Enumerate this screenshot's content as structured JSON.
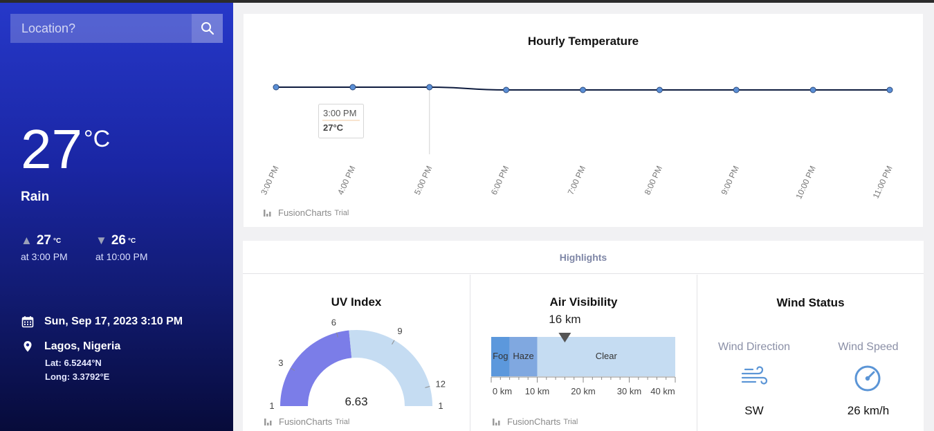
{
  "search": {
    "placeholder": "Location?"
  },
  "current": {
    "temperature": "27",
    "unit": "°C",
    "condition": "Rain",
    "high": {
      "value": "27",
      "unit": "°C",
      "at": "at 3:00 PM"
    },
    "low": {
      "value": "26",
      "unit": "°C",
      "at": "at 10:00 PM"
    },
    "datetime": "Sun, Sep 17, 2023 3:10 PM",
    "location": "Lagos, Nigeria",
    "lat": "Lat: 6.5244°N",
    "long": "Long: 3.3792°E"
  },
  "icons": {
    "search": "search-icon",
    "calendar": "calendar-icon",
    "location": "map-pin-icon",
    "wind": "wind-icon",
    "speed": "speedometer-icon"
  },
  "chart_data": [
    {
      "type": "line",
      "title": "Hourly Temperature",
      "x": [
        "3:00 PM",
        "4:00 PM",
        "5:00 PM",
        "6:00 PM",
        "7:00 PM",
        "8:00 PM",
        "9:00 PM",
        "10:00 PM",
        "11:00 PM"
      ],
      "values": [
        27,
        27,
        27,
        26,
        26,
        26,
        26,
        26,
        26
      ],
      "unit": "°C",
      "tooltip": {
        "label": "3:00 PM",
        "value": "27°C"
      },
      "color": "#0d1b3e",
      "marker_color": "#5b8fd6"
    }
  ],
  "trial_watermark": {
    "brand": "FusionCharts",
    "suffix": "Trial"
  },
  "highlights": {
    "title": "Highlights",
    "uv": {
      "title": "UV Index",
      "value": 6.63,
      "value_text": "6.63",
      "min_label": "1",
      "max_label": "1",
      "ticks": [
        "3",
        "6",
        "9",
        "12"
      ],
      "fill_color": "#7b7de8",
      "track_color": "#c5dcf2"
    },
    "visibility": {
      "title": "Air Visibility",
      "value_text": "16 km",
      "value_km": 16,
      "bands": [
        {
          "label": "Fog",
          "from": 0,
          "to": 4,
          "color": "#5c98dc"
        },
        {
          "label": "Haze",
          "from": 4,
          "to": 10,
          "color": "#80a8e0"
        },
        {
          "label": "Clear",
          "from": 10,
          "to": 40,
          "color": "#c5dcf2"
        }
      ],
      "axis_labels": [
        "0 km",
        "10 km",
        "20 km",
        "30 km",
        "40 km"
      ]
    },
    "wind": {
      "title": "Wind Status",
      "direction_label": "Wind Direction",
      "direction_value": "SW",
      "speed_label": "Wind Speed",
      "speed_value": "26 km/h",
      "icon_color": "#5b95d6"
    }
  }
}
